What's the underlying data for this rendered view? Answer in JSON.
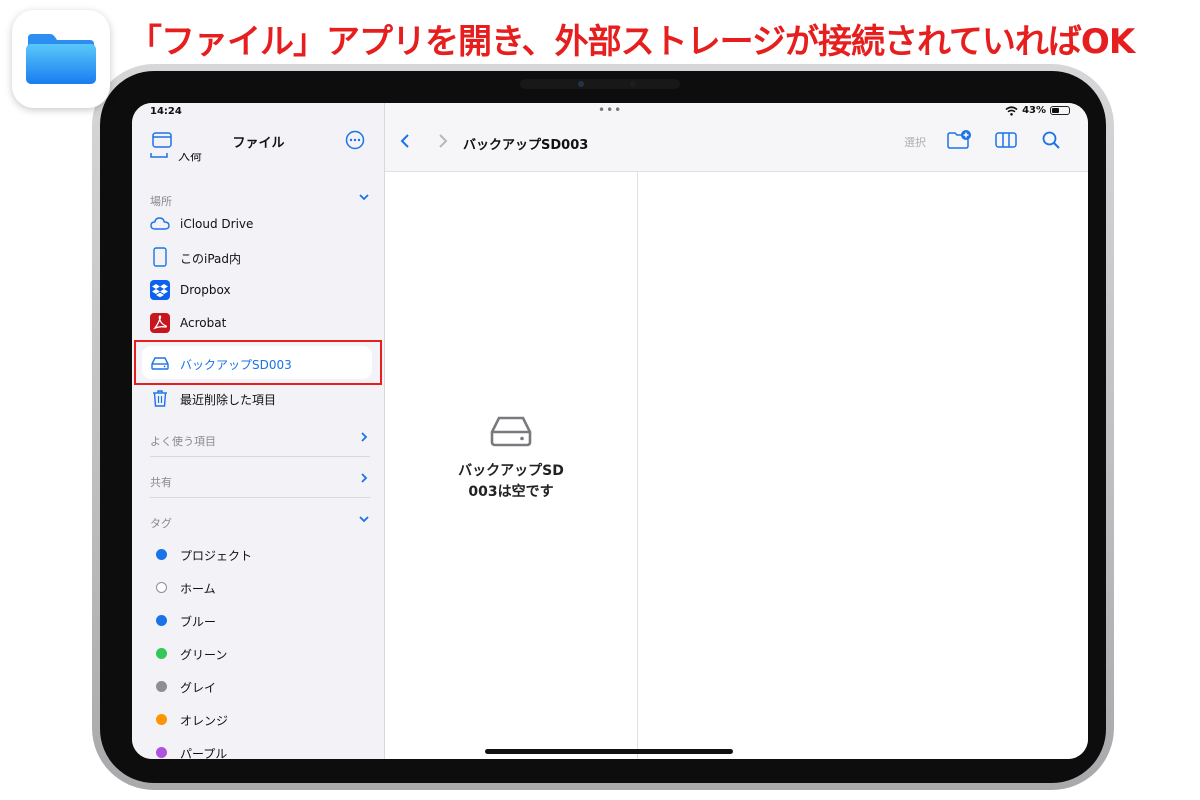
{
  "headline": "「ファイル」アプリを開き、外部ストレージが接続されていればOK",
  "status": {
    "time": "14:24",
    "battery": "43%",
    "battery_level": 0.43
  },
  "sidebar": {
    "title": "ファイル",
    "partial_item": "入荷",
    "locations_header": "場所",
    "locations": [
      {
        "label": "iCloud Drive",
        "icon": "icloud-icon"
      },
      {
        "label": "このiPad内",
        "icon": "ipad-icon"
      },
      {
        "label": "Dropbox",
        "icon": "dropbox-icon"
      },
      {
        "label": "Acrobat",
        "icon": "acrobat-icon"
      },
      {
        "label": "バックアップSD003",
        "icon": "external-drive-icon",
        "selected": true
      },
      {
        "label": "最近削除した項目",
        "icon": "trash-icon"
      }
    ],
    "favorites_header": "よく使う項目",
    "shared_header": "共有",
    "tags_header": "タグ",
    "tags": [
      {
        "label": "プロジェクト",
        "color": "#1a73e8"
      },
      {
        "label": "ホーム",
        "color": "outline"
      },
      {
        "label": "ブルー",
        "color": "#1a73e8"
      },
      {
        "label": "グリーン",
        "color": "#34c759"
      },
      {
        "label": "グレイ",
        "color": "#8e8e93"
      },
      {
        "label": "オレンジ",
        "color": "#ff9500"
      },
      {
        "label": "パープル",
        "color": "#af52de"
      }
    ]
  },
  "toolbar": {
    "folder_title": "バックアップSD003",
    "select_label": "選択"
  },
  "content": {
    "empty_line1": "バックアップSD",
    "empty_line2": "003は空です"
  },
  "colors": {
    "accent": "#1a73e8",
    "highlight": "#e61e1e",
    "sidebar_bg": "#f2f2f7"
  }
}
